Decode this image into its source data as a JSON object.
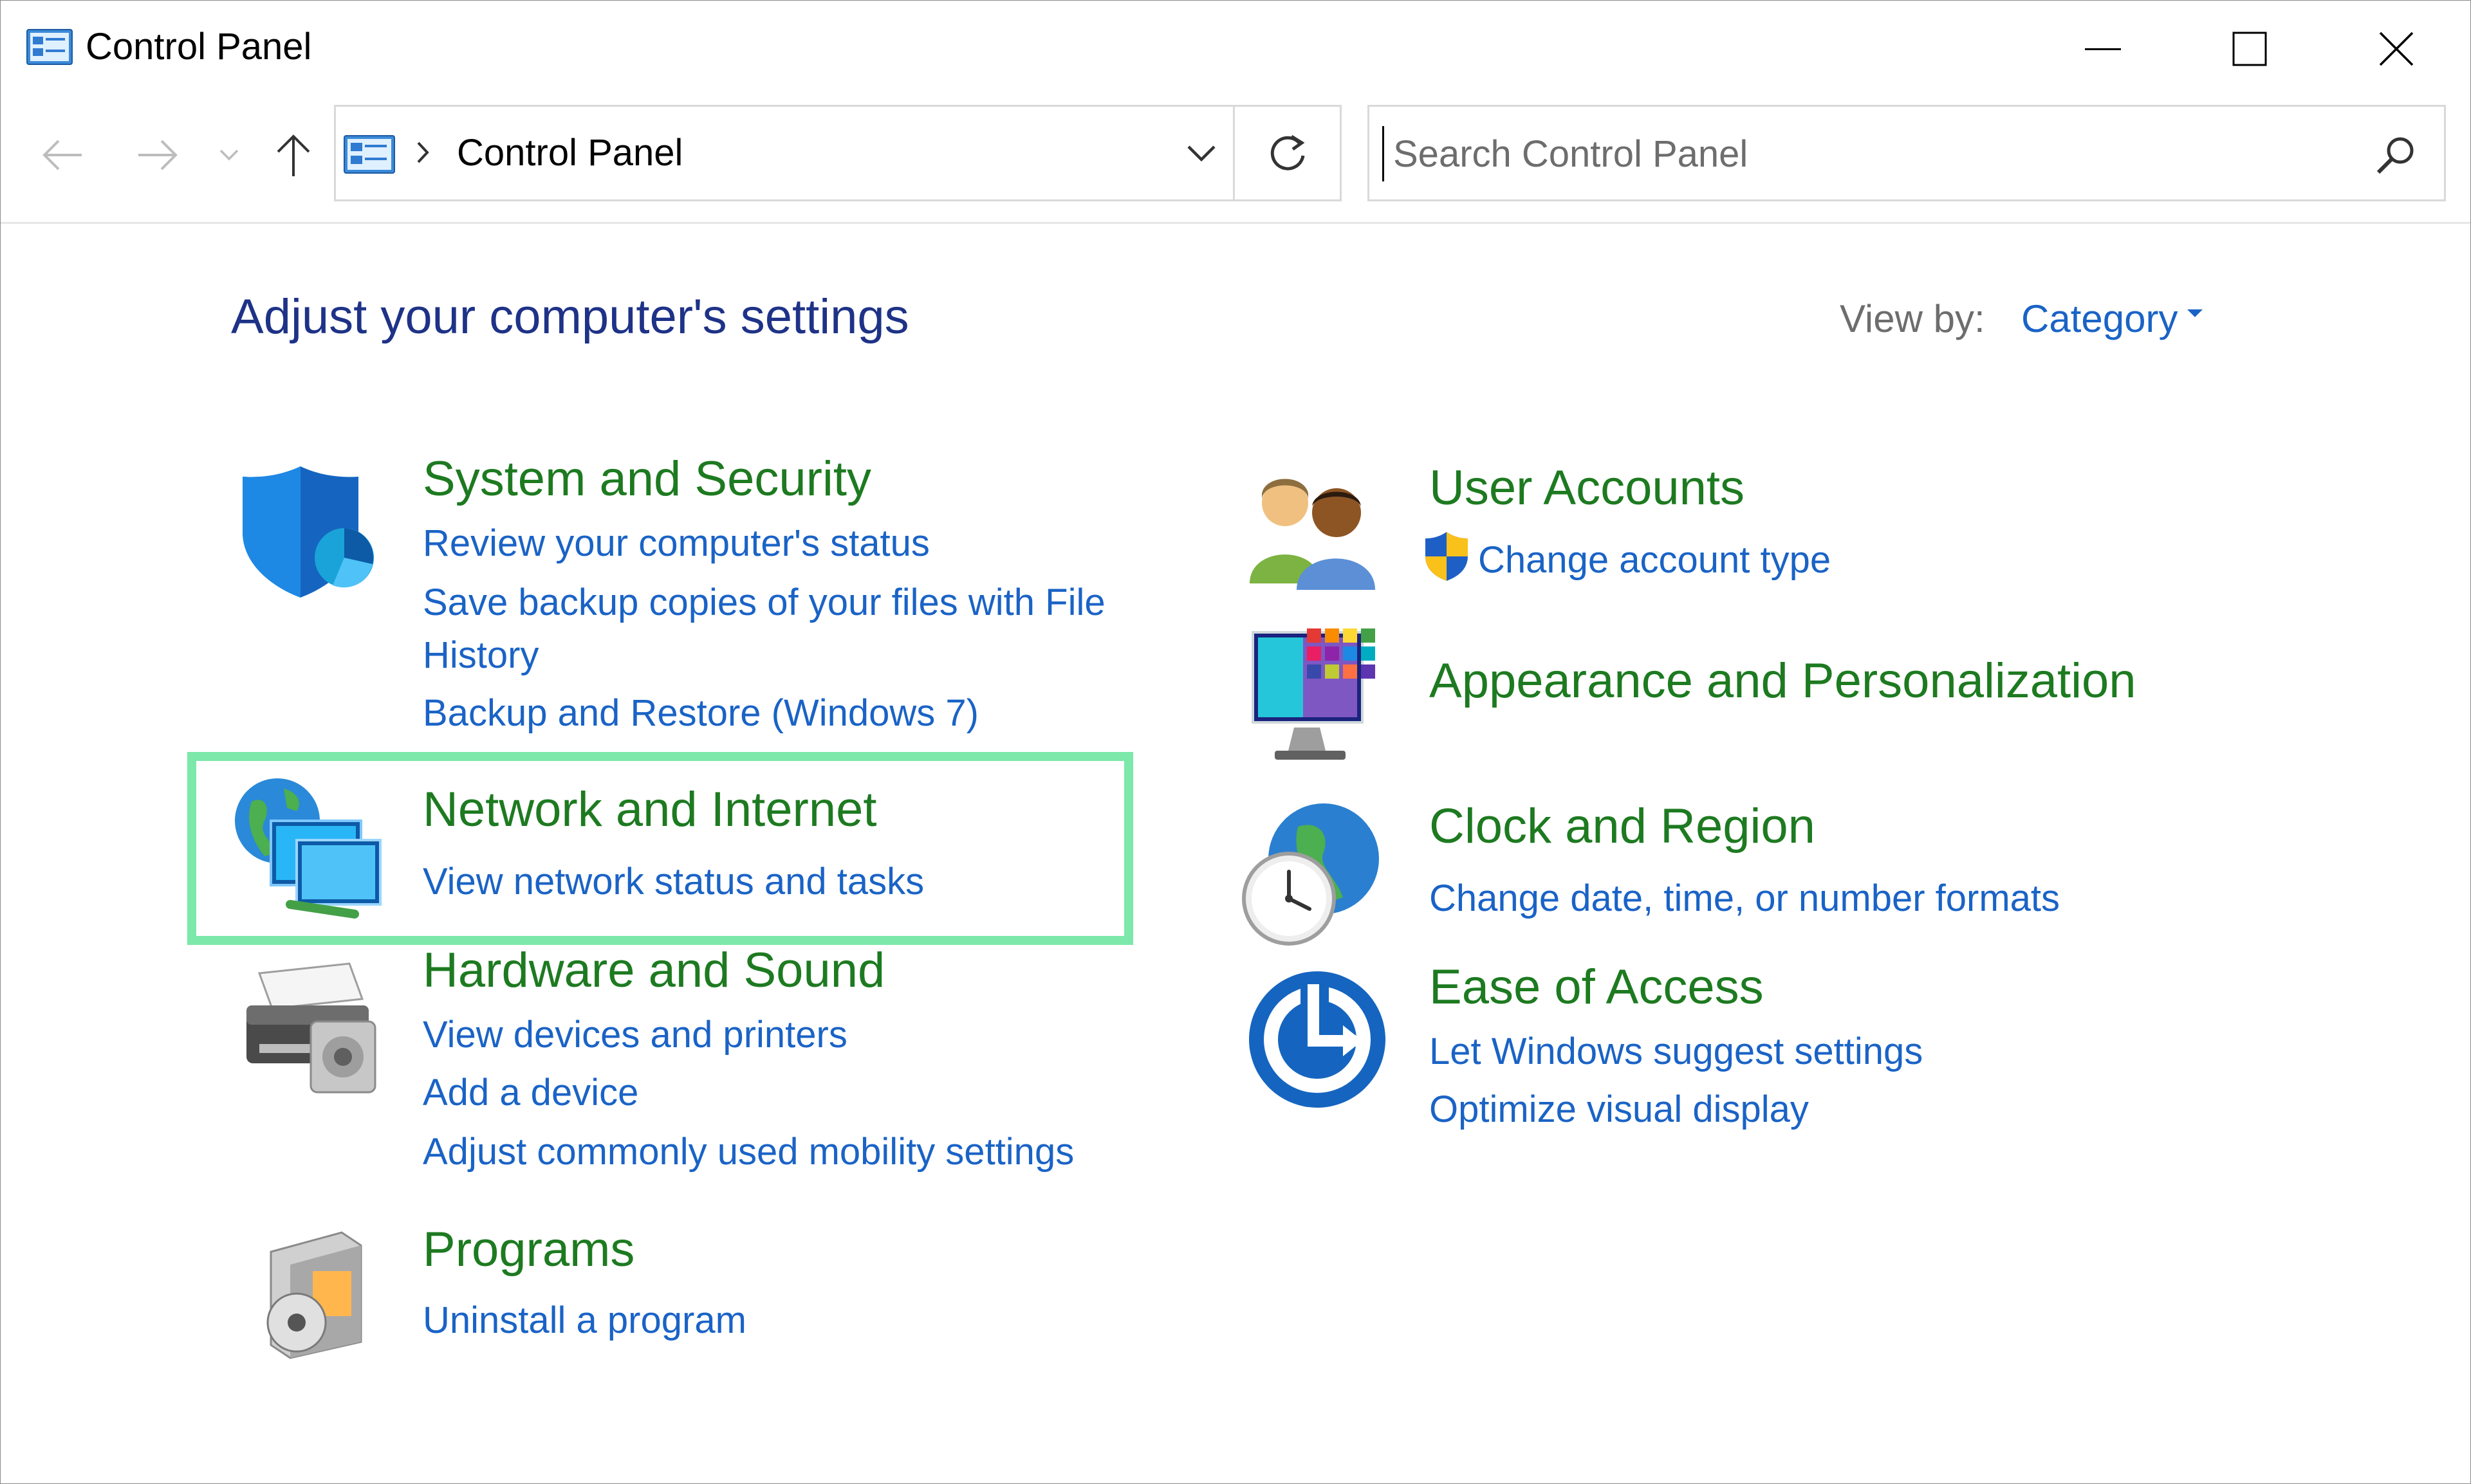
{
  "window": {
    "title": "Control Panel",
    "controls": {
      "minimize_icon": "minimize-icon",
      "maximize_icon": "maximize-icon",
      "close_icon": "close-icon"
    }
  },
  "nav": {
    "back_icon": "back-arrow-icon",
    "forward_icon": "forward-arrow-icon",
    "recent_icon": "chevron-down-icon",
    "up_icon": "up-arrow-icon"
  },
  "address": {
    "breadcrumb": "Control Panel",
    "dropdown_icon": "chevron-down-icon",
    "refresh_icon": "refresh-icon"
  },
  "search": {
    "placeholder": "Search Control Panel",
    "value": "",
    "icon": "search-icon"
  },
  "main": {
    "title": "Adjust your computer's settings",
    "view_by": {
      "label": "View by:",
      "value": "Category"
    }
  },
  "categories": {
    "system_security": {
      "title": "System and Security",
      "links": [
        "Review your computer's status",
        "Save backup copies of your files with File",
        "History",
        "Backup and Restore (Windows 7)"
      ]
    },
    "network_internet": {
      "title": "Network and Internet",
      "links": [
        "View network status and tasks"
      ]
    },
    "hardware_sound": {
      "title": "Hardware and Sound",
      "links": [
        "View devices and printers",
        "Add a device",
        "Adjust commonly used mobility settings"
      ]
    },
    "programs": {
      "title": "Programs",
      "links": [
        "Uninstall a program"
      ]
    },
    "user_accounts": {
      "title": "User Accounts",
      "links": [
        "Change account type"
      ]
    },
    "appearance": {
      "title": "Appearance and Personalization",
      "links": []
    },
    "clock_region": {
      "title": "Clock and Region",
      "links": [
        "Change date, time, or number formats"
      ]
    },
    "ease_access": {
      "title": "Ease of Access",
      "links": [
        "Let Windows suggest settings",
        "Optimize visual display"
      ]
    }
  },
  "colors": {
    "title_blue": "#1e3287",
    "category_green": "#1d7a20",
    "link_blue": "#1a63c6",
    "highlight_green": "#7ce8a9"
  }
}
